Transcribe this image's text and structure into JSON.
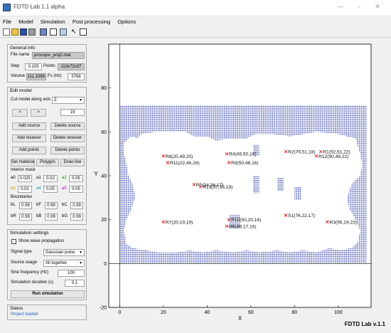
{
  "window": {
    "title": "FDTD Lab 1.1 alpha",
    "controls": [
      "—",
      "▫",
      "✕"
    ]
  },
  "menu": [
    "File",
    "Model",
    "Simulation",
    "Post processing",
    "Options"
  ],
  "toolbar_icons": [
    "new-icon",
    "open-icon",
    "save-icon",
    "print-icon",
    "export-icon",
    "grid-icon",
    "zoom-icon",
    "pointer-icon",
    "layout-icon"
  ],
  "general": {
    "title": "General info",
    "file_label": "File name",
    "file_value": "procopio_proj2.mat",
    "step_label": "Step",
    "step_value": "0.103",
    "points_label": "Points",
    "points_value": "113x72x37",
    "volume_label": "Volume",
    "volume_value": "111.1085",
    "fs_label": "Fs (Hz)",
    "fs_value": "5768"
  },
  "edit": {
    "title": "Edit model",
    "cut_label": "Cut model along axis",
    "cut_value": "Z",
    "prev": "<",
    "next": ">",
    "slice": "19",
    "add_source": "Add source",
    "delete_source": "Delete source",
    "add_receiver": "Add receiver",
    "delete_receiver": "Delete receiver",
    "add_points": "Add points",
    "delete_points": "Delete points",
    "set_material": "Set material",
    "polygon": "Polygon",
    "draw_line": "Draw line",
    "mask_label": "Interior mask",
    "mask": [
      {
        "k": "a0",
        "v": "0.025",
        "c": "#000000"
      },
      {
        "k": "a1",
        "v": "0.02",
        "c": "#000000"
      },
      {
        "k": "a2",
        "v": "0.05",
        "c": "#00a000"
      },
      {
        "k": "a3",
        "v": "0.02",
        "c": "#c8a000"
      },
      {
        "k": "a4",
        "v": "0.05",
        "c": "#00a0a0"
      },
      {
        "k": "a5",
        "v": "0.05",
        "c": "#c000c0"
      }
    ],
    "boundaries_label": "Boundaries",
    "boundaries": [
      {
        "k": "bL",
        "v": "0.99"
      },
      {
        "k": "bF",
        "v": "0.99"
      },
      {
        "k": "bC",
        "v": "0.99"
      },
      {
        "k": "bR",
        "v": "0.99"
      },
      {
        "k": "bB",
        "v": "0.99"
      },
      {
        "k": "bG",
        "v": "0.99"
      }
    ]
  },
  "sim": {
    "title": "Simulation settings",
    "show_wave": "Show wave propagation",
    "signal_label": "Signal type",
    "signal_value": "Gaussian pulse",
    "usage_label": "Source usage",
    "usage_value": "All together",
    "freq_label": "Sine frequency (Hz)",
    "freq_value": "100",
    "dur_label": "Simulation duration (s)",
    "dur_value": "0.1",
    "run": "Run simulation"
  },
  "status": {
    "title": "Status",
    "text": "Project loaded",
    "color": "#1f5fbf"
  },
  "brand": "FDTD Lab v.1.1",
  "colors": {
    "grid": "#2233a0",
    "marker": "#d02020"
  },
  "chart_data": {
    "type": "scatter",
    "xlabel": "X",
    "ylabel": "Y",
    "xlim": [
      -5,
      115
    ],
    "ylim": [
      -20,
      100
    ],
    "xticks": [
      0,
      20,
      40,
      60,
      80,
      100
    ],
    "yticks": [
      -20,
      0,
      20,
      40,
      60,
      80
    ],
    "grid_region": {
      "x": [
        0,
        113
      ],
      "y": [
        0,
        72
      ]
    },
    "sources": [
      {
        "label": "S1(76,22,17)",
        "x": 76,
        "y": 22
      }
    ],
    "receivers": [
      {
        "label": "R1(92,51,22)",
        "x": 92,
        "y": 51
      },
      {
        "label": "R2(76,51,18)",
        "x": 76,
        "y": 51
      },
      {
        "label": "R3(95,19,23)",
        "x": 95,
        "y": 19
      },
      {
        "label": "R4(49,50,16)",
        "x": 49,
        "y": 50
      },
      {
        "label": "R5(34,36,17)",
        "x": 34,
        "y": 36
      },
      {
        "label": "R6(49,17,16)",
        "x": 49,
        "y": 17
      },
      {
        "label": "R7(20,19,19)",
        "x": 20,
        "y": 19
      },
      {
        "label": "R8(20,49,20)",
        "x": 20,
        "y": 49
      },
      {
        "label": "R9(50,46,16)",
        "x": 50,
        "y": 46
      },
      {
        "label": "R10(50,20,16)",
        "x": 50,
        "y": 20
      },
      {
        "label": "R11(22,46,16)",
        "x": 22,
        "y": 46
      },
      {
        "label": "R12(90,49,22)",
        "x": 90,
        "y": 49
      },
      {
        "label": "R13(37,35,19)",
        "x": 37,
        "y": 35
      }
    ]
  }
}
